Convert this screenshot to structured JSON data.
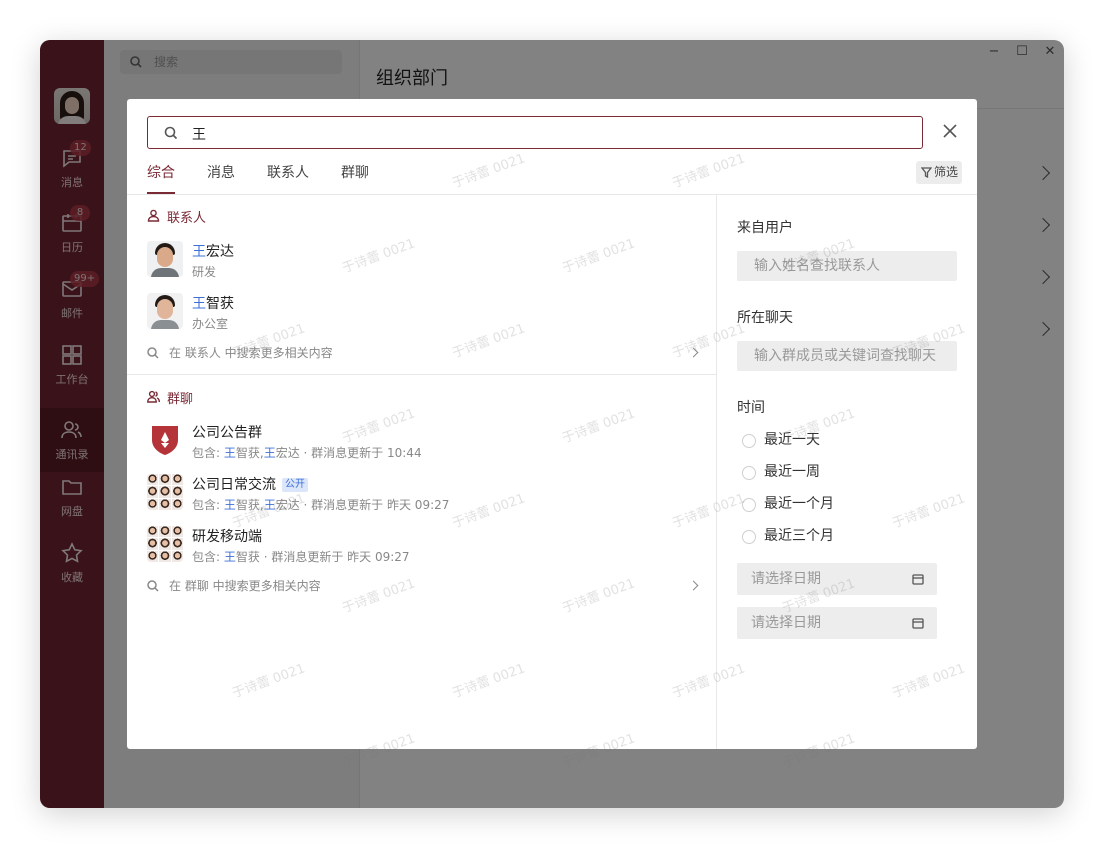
{
  "sidebar": {
    "items": [
      {
        "label": "消息",
        "badge": "12",
        "icon": "chat-icon"
      },
      {
        "label": "日历",
        "badge": "8",
        "icon": "calendar-icon"
      },
      {
        "label": "邮件",
        "badge": "99+",
        "icon": "mail-icon"
      },
      {
        "label": "工作台",
        "badge": "",
        "icon": "grid-icon"
      },
      {
        "label": "通讯录",
        "badge": "",
        "icon": "contacts-icon",
        "active": true
      },
      {
        "label": "网盘",
        "badge": "",
        "icon": "folder-icon"
      },
      {
        "label": "收藏",
        "badge": "",
        "icon": "star-icon"
      }
    ]
  },
  "background": {
    "search_placeholder": "搜索",
    "title": "组织部门"
  },
  "window_controls": {
    "minimize": "−",
    "maximize": "☐",
    "close": "✕"
  },
  "watermark": "于诗蕾 0021",
  "search": {
    "value": "王"
  },
  "tabs": [
    {
      "label": "综合",
      "active": true
    },
    {
      "label": "消息"
    },
    {
      "label": "联系人"
    },
    {
      "label": "群聊"
    }
  ],
  "filter_label": "筛选",
  "contacts": {
    "title": "联系人",
    "items": [
      {
        "highlight": "王",
        "rest": "宏达",
        "sub": "研发"
      },
      {
        "highlight": "王",
        "rest": "智获",
        "sub": "办公室"
      }
    ],
    "more": "在 联系人 中搜索更多相关内容"
  },
  "groups": {
    "title": "群聊",
    "items": [
      {
        "name": "公司公告群",
        "tag": "",
        "sub_prefix": "包含: ",
        "h1": "王",
        "m1": "智获,",
        "h2": "王",
        "m2": "宏达",
        "sub_suffix": " · 群消息更新于 10:44"
      },
      {
        "name": "公司日常交流",
        "tag": "公开",
        "sub_prefix": "包含: ",
        "h1": "王",
        "m1": "智获,",
        "h2": "王",
        "m2": "宏达",
        "sub_suffix": " · 群消息更新于 昨天 09:27"
      },
      {
        "name": "研发移动端",
        "tag": "",
        "sub_prefix": "包含: ",
        "h1": "王",
        "m1": "智获",
        "h2": "",
        "m2": "",
        "sub_suffix": " · 群消息更新于 昨天 09:27"
      }
    ],
    "more": "在 群聊 中搜索更多相关内容"
  },
  "filter_panel": {
    "from_user_label": "来自用户",
    "from_user_placeholder": "输入姓名查找联系人",
    "chat_label": "所在聊天",
    "chat_placeholder": "输入群成员或关键词查找聊天",
    "time_label": "时间",
    "time_options": [
      "最近一天",
      "最近一周",
      "最近一个月",
      "最近三个月"
    ],
    "date_start_placeholder": "请选择日期",
    "date_end_placeholder": "请选择日期"
  },
  "colors": {
    "accent": "#7a2a35",
    "sidebar": "#6e2530",
    "highlight": "#3d6fd8"
  }
}
